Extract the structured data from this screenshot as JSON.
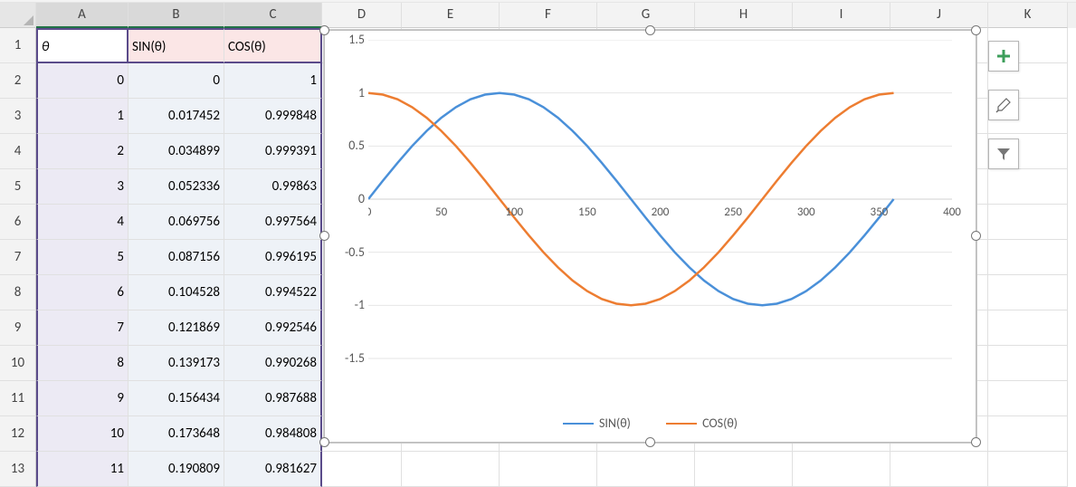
{
  "columns": [
    {
      "letter": "A",
      "width": 102,
      "sel": true
    },
    {
      "letter": "B",
      "width": 106,
      "sel": true
    },
    {
      "letter": "C",
      "width": 108,
      "sel": true
    },
    {
      "letter": "D",
      "width": 88,
      "sel": false
    },
    {
      "letter": "E",
      "width": 108,
      "sel": false
    },
    {
      "letter": "F",
      "width": 108,
      "sel": false
    },
    {
      "letter": "G",
      "width": 108,
      "sel": false
    },
    {
      "letter": "H",
      "width": 108,
      "sel": false
    },
    {
      "letter": "I",
      "width": 108,
      "sel": false
    },
    {
      "letter": "J",
      "width": 108,
      "sel": false
    },
    {
      "letter": "K",
      "width": 88,
      "sel": false
    }
  ],
  "rows_visible": [
    1,
    2,
    3,
    4,
    5,
    6,
    7,
    8,
    9,
    10,
    11,
    12,
    13
  ],
  "headers": {
    "A": "θ",
    "B": "SIN(θ)",
    "C": "COS(θ)"
  },
  "data_rows": [
    {
      "theta": "0",
      "sin": "0",
      "cos": "1"
    },
    {
      "theta": "1",
      "sin": "0.017452",
      "cos": "0.999848"
    },
    {
      "theta": "2",
      "sin": "0.034899",
      "cos": "0.999391"
    },
    {
      "theta": "3",
      "sin": "0.052336",
      "cos": "0.99863"
    },
    {
      "theta": "4",
      "sin": "0.069756",
      "cos": "0.997564"
    },
    {
      "theta": "5",
      "sin": "0.087156",
      "cos": "0.996195"
    },
    {
      "theta": "6",
      "sin": "0.104528",
      "cos": "0.994522"
    },
    {
      "theta": "7",
      "sin": "0.121869",
      "cos": "0.992546"
    },
    {
      "theta": "8",
      "sin": "0.139173",
      "cos": "0.990268"
    },
    {
      "theta": "9",
      "sin": "0.156434",
      "cos": "0.987688"
    },
    {
      "theta": "10",
      "sin": "0.173648",
      "cos": "0.984808"
    },
    {
      "theta": "11",
      "sin": "0.190809",
      "cos": "0.981627"
    }
  ],
  "chart_data": {
    "type": "line",
    "title": "",
    "xlabel": "",
    "ylabel": "",
    "xlim": [
      0,
      400
    ],
    "ylim": [
      -1.5,
      1.5
    ],
    "xticks": [
      0,
      50,
      100,
      150,
      200,
      250,
      300,
      350,
      400
    ],
    "yticks": [
      -1.5,
      -1,
      -0.5,
      0,
      0.5,
      1,
      1.5
    ],
    "legend": [
      "SIN(θ)",
      "COS(θ)"
    ],
    "colors": {
      "SIN(θ)": "#4a90d9",
      "COS(θ)": "#ed7d31"
    },
    "x": [
      0,
      10,
      20,
      30,
      40,
      50,
      60,
      70,
      80,
      90,
      100,
      110,
      120,
      130,
      140,
      150,
      160,
      170,
      180,
      190,
      200,
      210,
      220,
      230,
      240,
      250,
      260,
      270,
      280,
      290,
      300,
      310,
      320,
      330,
      340,
      350,
      360
    ],
    "series": [
      {
        "name": "SIN(θ)",
        "values": [
          0,
          0.1736,
          0.342,
          0.5,
          0.6428,
          0.766,
          0.866,
          0.9397,
          0.9848,
          1,
          0.9848,
          0.9397,
          0.866,
          0.766,
          0.6428,
          0.5,
          0.342,
          0.1736,
          0,
          -0.1736,
          -0.342,
          -0.5,
          -0.6428,
          -0.766,
          -0.866,
          -0.9397,
          -0.9848,
          -1,
          -0.9848,
          -0.9397,
          -0.866,
          -0.766,
          -0.6428,
          -0.5,
          -0.342,
          -0.1736,
          0
        ]
      },
      {
        "name": "COS(θ)",
        "values": [
          1,
          0.9848,
          0.9397,
          0.866,
          0.766,
          0.6428,
          0.5,
          0.342,
          0.1736,
          0,
          -0.1736,
          -0.342,
          -0.5,
          -0.6428,
          -0.766,
          -0.866,
          -0.9397,
          -0.9848,
          -1,
          -0.9848,
          -0.9397,
          -0.866,
          -0.766,
          -0.6428,
          -0.5,
          -0.342,
          -0.1736,
          0,
          0.1736,
          0.342,
          0.5,
          0.6428,
          0.766,
          0.866,
          0.9397,
          0.9848,
          1
        ]
      }
    ]
  },
  "side_buttons": [
    "add",
    "brush",
    "filter"
  ]
}
